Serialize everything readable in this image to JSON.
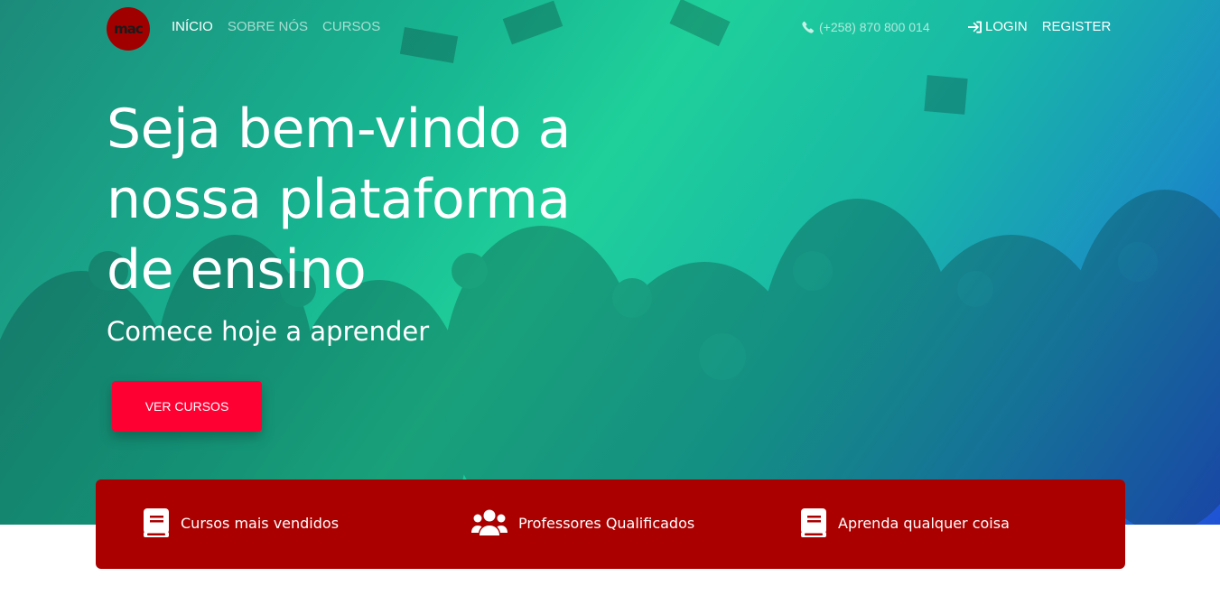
{
  "navbar": {
    "logo_text": "mac",
    "links": [
      {
        "label": "INÍCIO",
        "active": true
      },
      {
        "label": "SOBRE NÓS",
        "active": false
      },
      {
        "label": "CURSOS",
        "active": false
      }
    ],
    "phone": "(+258) 870 800 014",
    "login_label": "LOGIN",
    "register_label": "REGISTER"
  },
  "hero": {
    "headline": "Seja bem-vindo a nossa plataforma de ensino",
    "subtitle": "Comece hoje a aprender",
    "cta_label": "VER CURSOS"
  },
  "features": [
    {
      "label": "Cursos mais vendidos",
      "icon": "book-icon"
    },
    {
      "label": "Professores Qualificados",
      "icon": "users-icon"
    },
    {
      "label": "Aprenda qualquer coisa",
      "icon": "book-icon"
    }
  ],
  "colors": {
    "accent_red": "#ff0033",
    "features_bar": "#aa0000",
    "logo_bg": "#a10000"
  }
}
